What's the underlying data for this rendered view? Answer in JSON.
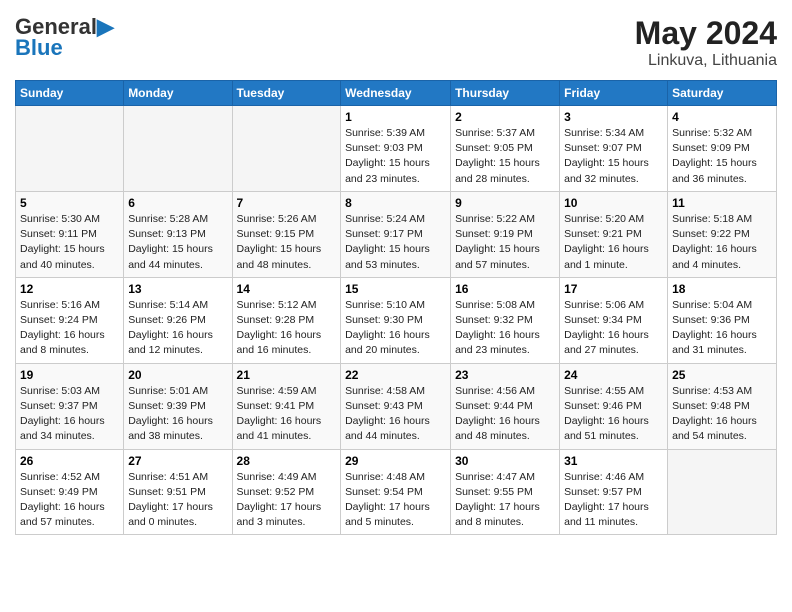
{
  "header": {
    "logo_line1": "General",
    "logo_line2": "Blue",
    "month_year": "May 2024",
    "location": "Linkuva, Lithuania"
  },
  "days_of_week": [
    "Sunday",
    "Monday",
    "Tuesday",
    "Wednesday",
    "Thursday",
    "Friday",
    "Saturday"
  ],
  "weeks": [
    [
      {
        "num": "",
        "info": ""
      },
      {
        "num": "",
        "info": ""
      },
      {
        "num": "",
        "info": ""
      },
      {
        "num": "1",
        "info": "Sunrise: 5:39 AM\nSunset: 9:03 PM\nDaylight: 15 hours\nand 23 minutes."
      },
      {
        "num": "2",
        "info": "Sunrise: 5:37 AM\nSunset: 9:05 PM\nDaylight: 15 hours\nand 28 minutes."
      },
      {
        "num": "3",
        "info": "Sunrise: 5:34 AM\nSunset: 9:07 PM\nDaylight: 15 hours\nand 32 minutes."
      },
      {
        "num": "4",
        "info": "Sunrise: 5:32 AM\nSunset: 9:09 PM\nDaylight: 15 hours\nand 36 minutes."
      }
    ],
    [
      {
        "num": "5",
        "info": "Sunrise: 5:30 AM\nSunset: 9:11 PM\nDaylight: 15 hours\nand 40 minutes."
      },
      {
        "num": "6",
        "info": "Sunrise: 5:28 AM\nSunset: 9:13 PM\nDaylight: 15 hours\nand 44 minutes."
      },
      {
        "num": "7",
        "info": "Sunrise: 5:26 AM\nSunset: 9:15 PM\nDaylight: 15 hours\nand 48 minutes."
      },
      {
        "num": "8",
        "info": "Sunrise: 5:24 AM\nSunset: 9:17 PM\nDaylight: 15 hours\nand 53 minutes."
      },
      {
        "num": "9",
        "info": "Sunrise: 5:22 AM\nSunset: 9:19 PM\nDaylight: 15 hours\nand 57 minutes."
      },
      {
        "num": "10",
        "info": "Sunrise: 5:20 AM\nSunset: 9:21 PM\nDaylight: 16 hours\nand 1 minute."
      },
      {
        "num": "11",
        "info": "Sunrise: 5:18 AM\nSunset: 9:22 PM\nDaylight: 16 hours\nand 4 minutes."
      }
    ],
    [
      {
        "num": "12",
        "info": "Sunrise: 5:16 AM\nSunset: 9:24 PM\nDaylight: 16 hours\nand 8 minutes."
      },
      {
        "num": "13",
        "info": "Sunrise: 5:14 AM\nSunset: 9:26 PM\nDaylight: 16 hours\nand 12 minutes."
      },
      {
        "num": "14",
        "info": "Sunrise: 5:12 AM\nSunset: 9:28 PM\nDaylight: 16 hours\nand 16 minutes."
      },
      {
        "num": "15",
        "info": "Sunrise: 5:10 AM\nSunset: 9:30 PM\nDaylight: 16 hours\nand 20 minutes."
      },
      {
        "num": "16",
        "info": "Sunrise: 5:08 AM\nSunset: 9:32 PM\nDaylight: 16 hours\nand 23 minutes."
      },
      {
        "num": "17",
        "info": "Sunrise: 5:06 AM\nSunset: 9:34 PM\nDaylight: 16 hours\nand 27 minutes."
      },
      {
        "num": "18",
        "info": "Sunrise: 5:04 AM\nSunset: 9:36 PM\nDaylight: 16 hours\nand 31 minutes."
      }
    ],
    [
      {
        "num": "19",
        "info": "Sunrise: 5:03 AM\nSunset: 9:37 PM\nDaylight: 16 hours\nand 34 minutes."
      },
      {
        "num": "20",
        "info": "Sunrise: 5:01 AM\nSunset: 9:39 PM\nDaylight: 16 hours\nand 38 minutes."
      },
      {
        "num": "21",
        "info": "Sunrise: 4:59 AM\nSunset: 9:41 PM\nDaylight: 16 hours\nand 41 minutes."
      },
      {
        "num": "22",
        "info": "Sunrise: 4:58 AM\nSunset: 9:43 PM\nDaylight: 16 hours\nand 44 minutes."
      },
      {
        "num": "23",
        "info": "Sunrise: 4:56 AM\nSunset: 9:44 PM\nDaylight: 16 hours\nand 48 minutes."
      },
      {
        "num": "24",
        "info": "Sunrise: 4:55 AM\nSunset: 9:46 PM\nDaylight: 16 hours\nand 51 minutes."
      },
      {
        "num": "25",
        "info": "Sunrise: 4:53 AM\nSunset: 9:48 PM\nDaylight: 16 hours\nand 54 minutes."
      }
    ],
    [
      {
        "num": "26",
        "info": "Sunrise: 4:52 AM\nSunset: 9:49 PM\nDaylight: 16 hours\nand 57 minutes."
      },
      {
        "num": "27",
        "info": "Sunrise: 4:51 AM\nSunset: 9:51 PM\nDaylight: 17 hours\nand 0 minutes."
      },
      {
        "num": "28",
        "info": "Sunrise: 4:49 AM\nSunset: 9:52 PM\nDaylight: 17 hours\nand 3 minutes."
      },
      {
        "num": "29",
        "info": "Sunrise: 4:48 AM\nSunset: 9:54 PM\nDaylight: 17 hours\nand 5 minutes."
      },
      {
        "num": "30",
        "info": "Sunrise: 4:47 AM\nSunset: 9:55 PM\nDaylight: 17 hours\nand 8 minutes."
      },
      {
        "num": "31",
        "info": "Sunrise: 4:46 AM\nSunset: 9:57 PM\nDaylight: 17 hours\nand 11 minutes."
      },
      {
        "num": "",
        "info": ""
      }
    ]
  ]
}
